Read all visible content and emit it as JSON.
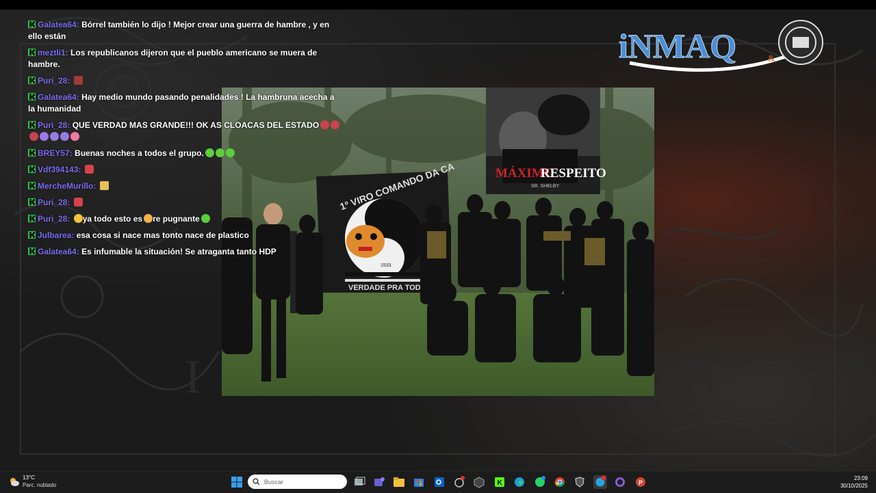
{
  "chat": {
    "messages": [
      {
        "user": "Galatea64",
        "text": "Bórrel también lo dijo ! Mejor crear una guerra de hambre , y en ello están",
        "emotes": []
      },
      {
        "user": "meztli1",
        "text": "Los republicanos dijeron que el pueblo americano se muera de hambre.",
        "emotes": []
      },
      {
        "user": "Puri_28",
        "text": "",
        "emotes": [
          "avatar"
        ]
      },
      {
        "user": "Galatea64",
        "text": "Hay medio mundo pasando penalidades ! La hambruna acecha a la humanidad",
        "emotes": []
      },
      {
        "user": "Puri_28",
        "text": "QUE VERDAD MAS GRANDE!!! OK AS CLOACAS DEL ESTADO",
        "emotes": [
          "poop",
          "poop",
          "poop",
          "devil",
          "devil",
          "devil",
          "pig"
        ]
      },
      {
        "user": "BREY57",
        "text": "Buenas noches a todos el grupo.",
        "emotes": [
          "nause",
          "nause",
          "nause"
        ]
      },
      {
        "user": "Vdf394143",
        "text": "",
        "emotes": [
          "angry"
        ]
      },
      {
        "user": "MercheMurillo",
        "text": "",
        "emotes": [
          "wing"
        ]
      },
      {
        "user": "Puri_28",
        "text": "",
        "emotes": [
          "angry"
        ]
      },
      {
        "user": "Puri_28",
        "text": "ya todo esto es",
        "text2": "re pugnante",
        "emotes": [
          "scream"
        ],
        "mid_emote": "cry",
        "end_emote": "nause"
      },
      {
        "user": "Julbarea",
        "text": "esa cosa si nace mas tonto nace de plastico",
        "emotes": []
      },
      {
        "user": "Galatea64",
        "text": "Es infumable la situación! Se atraganta tanto HDP",
        "emotes": []
      }
    ]
  },
  "photo": {
    "banner_line1": "1º VIRO COMANDO DA CA",
    "banner_line2": "VERDADE PRA TODOS",
    "banner_number": "1533",
    "poster_title_red": "MÁXIMO",
    "poster_title_white": "RESPEITO",
    "poster_subtitle": "SR. SHELBY"
  },
  "logo": {
    "text": "iNMAQ",
    "amp": "&"
  },
  "taskbar": {
    "weather_temp": "13°C",
    "weather_desc": "Parc. nublado",
    "search_placeholder": "Buscar",
    "time": "23:09",
    "date": "30/10/2025"
  },
  "colors": {
    "username": "#7c6cf0",
    "badge": "#22cc44",
    "chat_text": "#ffffff",
    "poster_red": "#d2232a"
  }
}
